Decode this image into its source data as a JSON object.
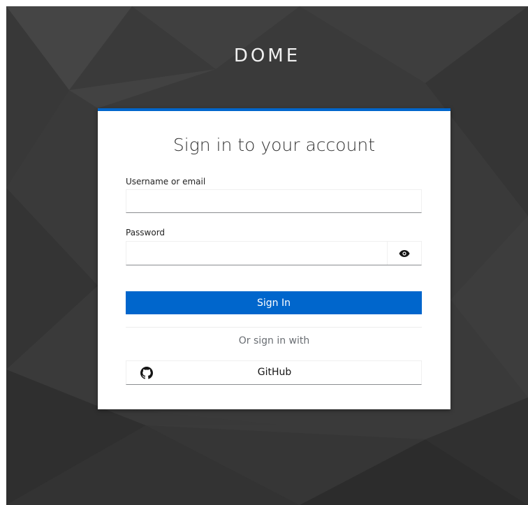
{
  "brand": {
    "title": "DOME"
  },
  "login": {
    "heading": "Sign in to your account",
    "username_label": "Username or email",
    "username_value": "",
    "password_label": "Password",
    "password_value": "",
    "show_password_icon": "eye-icon",
    "submit_label": "Sign In",
    "social_heading": "Or sign in with",
    "providers": [
      {
        "name": "GitHub",
        "icon": "github-icon"
      }
    ]
  },
  "colors": {
    "background": "#3a3a3a",
    "accent": "#0066cc",
    "card": "#ffffff"
  }
}
